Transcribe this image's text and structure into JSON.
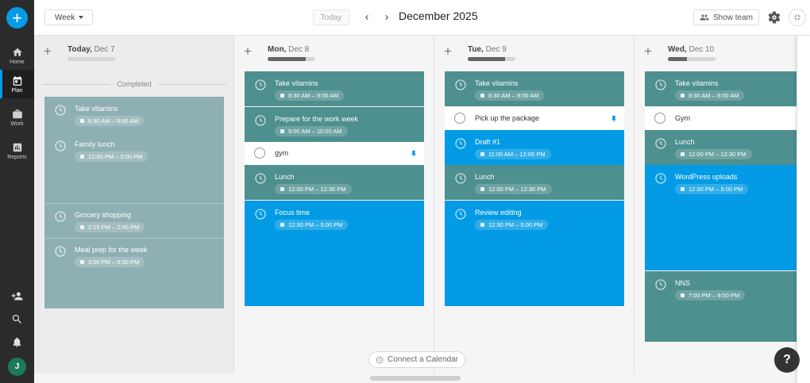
{
  "sidebar": {
    "add_label": "+",
    "items": [
      {
        "label": "Home",
        "icon": "home-icon"
      },
      {
        "label": "Plan",
        "icon": "calendar-icon"
      },
      {
        "label": "Work",
        "icon": "briefcase-icon"
      },
      {
        "label": "Reports",
        "icon": "chart-icon"
      }
    ],
    "avatar_initial": "J"
  },
  "header": {
    "view_select": "Week",
    "today_label": "Today",
    "prev": "‹",
    "next": "›",
    "month_title": "December 2025",
    "show_team_label": "Show team"
  },
  "colors": {
    "accent": "#039be5",
    "teal": "#4e8f8f",
    "faded": "#8fb0b3"
  },
  "columns": [
    {
      "day": "Today,",
      "date": " Dec 7",
      "progress_fraction": 0,
      "completed_label": "Completed",
      "tasks": [
        {
          "title": "Take vitamins",
          "time": "8:30 AM – 9:00 AM"
        },
        {
          "title": "Family lunch",
          "time": "12:00 PM – 2:00 PM"
        },
        {
          "title": "Grocery shopping",
          "time": "2:15 PM – 2:45 PM"
        },
        {
          "title": "Meal prep for the week",
          "time": "3:00 PM – 5:00 PM"
        }
      ]
    },
    {
      "day": "Mon,",
      "date": " Dec 8",
      "progress_fraction": 0.8,
      "tasks": [
        {
          "title": "Take vitamins",
          "time": "8:30 AM – 9:00 AM"
        },
        {
          "title": "Prepare for the work week",
          "time": "9:00 AM – 10:00 AM"
        },
        {
          "title": "gym",
          "time": ""
        },
        {
          "title": "Lunch",
          "time": "12:00 PM – 12:30 PM"
        },
        {
          "title": "Focus time",
          "time": "12:30 PM – 5:00 PM"
        }
      ]
    },
    {
      "day": "Tue,",
      "date": " Dec 9",
      "progress_fraction": 0.78,
      "tasks": [
        {
          "title": "Take vitamins",
          "time": "8:30 AM – 9:00 AM"
        },
        {
          "title": "Pick up the package",
          "time": ""
        },
        {
          "title": "Draft #1",
          "time": "11:00 AM – 12:00 PM"
        },
        {
          "title": "Lunch",
          "time": "12:00 PM – 12:30 PM"
        },
        {
          "title": "Review editing",
          "time": "12:30 PM – 5:00 PM"
        }
      ]
    },
    {
      "day": "Wed,",
      "date": " Dec 10",
      "progress_fraction": 0.4,
      "tasks": [
        {
          "title": "Take vitamins",
          "time": "8:30 AM – 9:00 AM"
        },
        {
          "title": "Gym",
          "time": ""
        },
        {
          "title": "Lunch",
          "time": "12:00 PM – 12:30 PM"
        },
        {
          "title": "WordPress uploads",
          "time": "12:30 PM – 5:00 PM"
        },
        {
          "title": "NNS",
          "time": "7:00 PM – 9:00 PM"
        }
      ]
    }
  ],
  "connect_calendar_label": "Connect a Calendar",
  "help_label": "?"
}
